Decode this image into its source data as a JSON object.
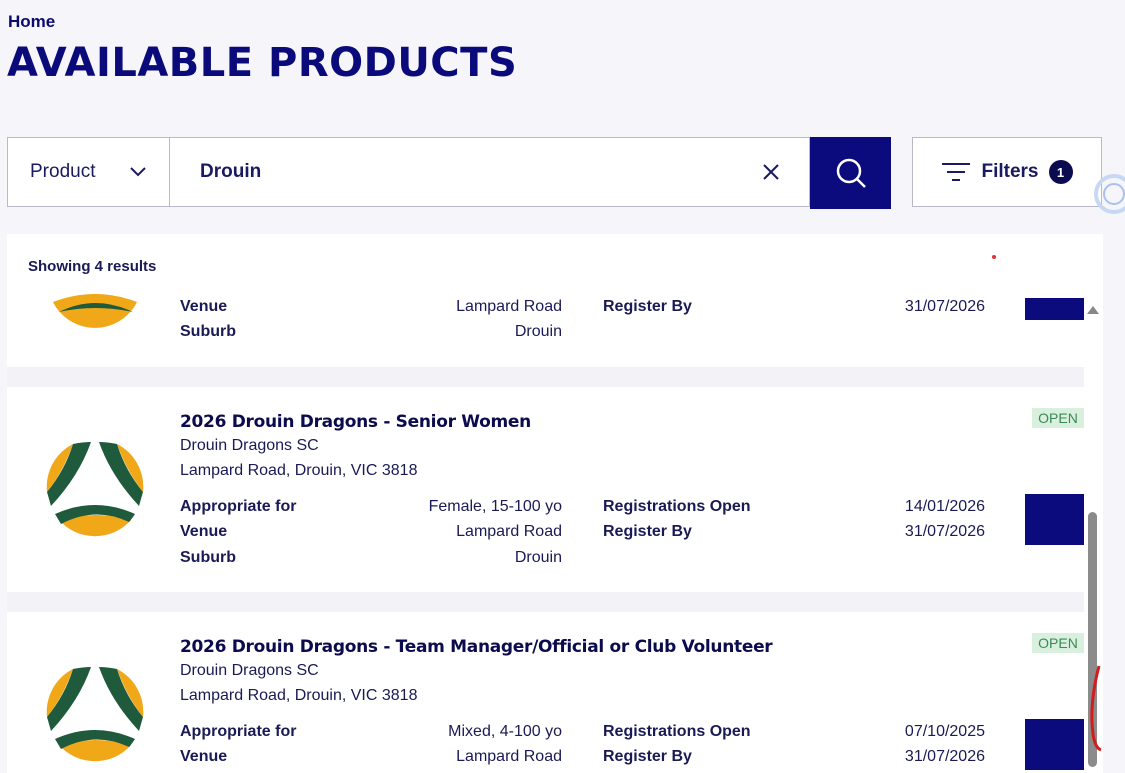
{
  "breadcrumb": "Home",
  "page_title": "AVAILABLE PRODUCTS",
  "search": {
    "category": "Product",
    "query": "Drouin"
  },
  "filters": {
    "label": "Filters",
    "count": "1"
  },
  "results_count": "Showing 4 results",
  "labels": {
    "appropriate_for": "Appropriate for",
    "venue": "Venue",
    "suburb": "Suburb",
    "registrations_open": "Registrations Open",
    "register_by": "Register By"
  },
  "partial_card": {
    "venue": "Lampard Road",
    "suburb": "Drouin",
    "register_by": "31/07/2026"
  },
  "cards": [
    {
      "title": "2026 Drouin Dragons - Senior Women",
      "club": "Drouin Dragons SC",
      "address": "Lampard Road, Drouin, VIC 3818",
      "appropriate_for": "Female, 15-100 yo",
      "venue": "Lampard Road",
      "suburb": "Drouin",
      "registrations_open": "14/01/2026",
      "register_by": "31/07/2026",
      "status": "OPEN"
    },
    {
      "title": "2026 Drouin Dragons - Team Manager/Official or Club Volunteer",
      "club": "Drouin Dragons SC",
      "address": "Lampard Road, Drouin, VIC 3818",
      "appropriate_for": "Mixed, 4-100 yo",
      "venue": "Lampard Road",
      "registrations_open": "07/10/2025",
      "register_by": "31/07/2026",
      "status": "OPEN"
    }
  ],
  "colors": {
    "navy": "#0b0b7d",
    "logo_green": "#1f5a3c",
    "logo_gold": "#f0a818",
    "open_bg": "#d9f0df",
    "open_text": "#3a8a55"
  }
}
